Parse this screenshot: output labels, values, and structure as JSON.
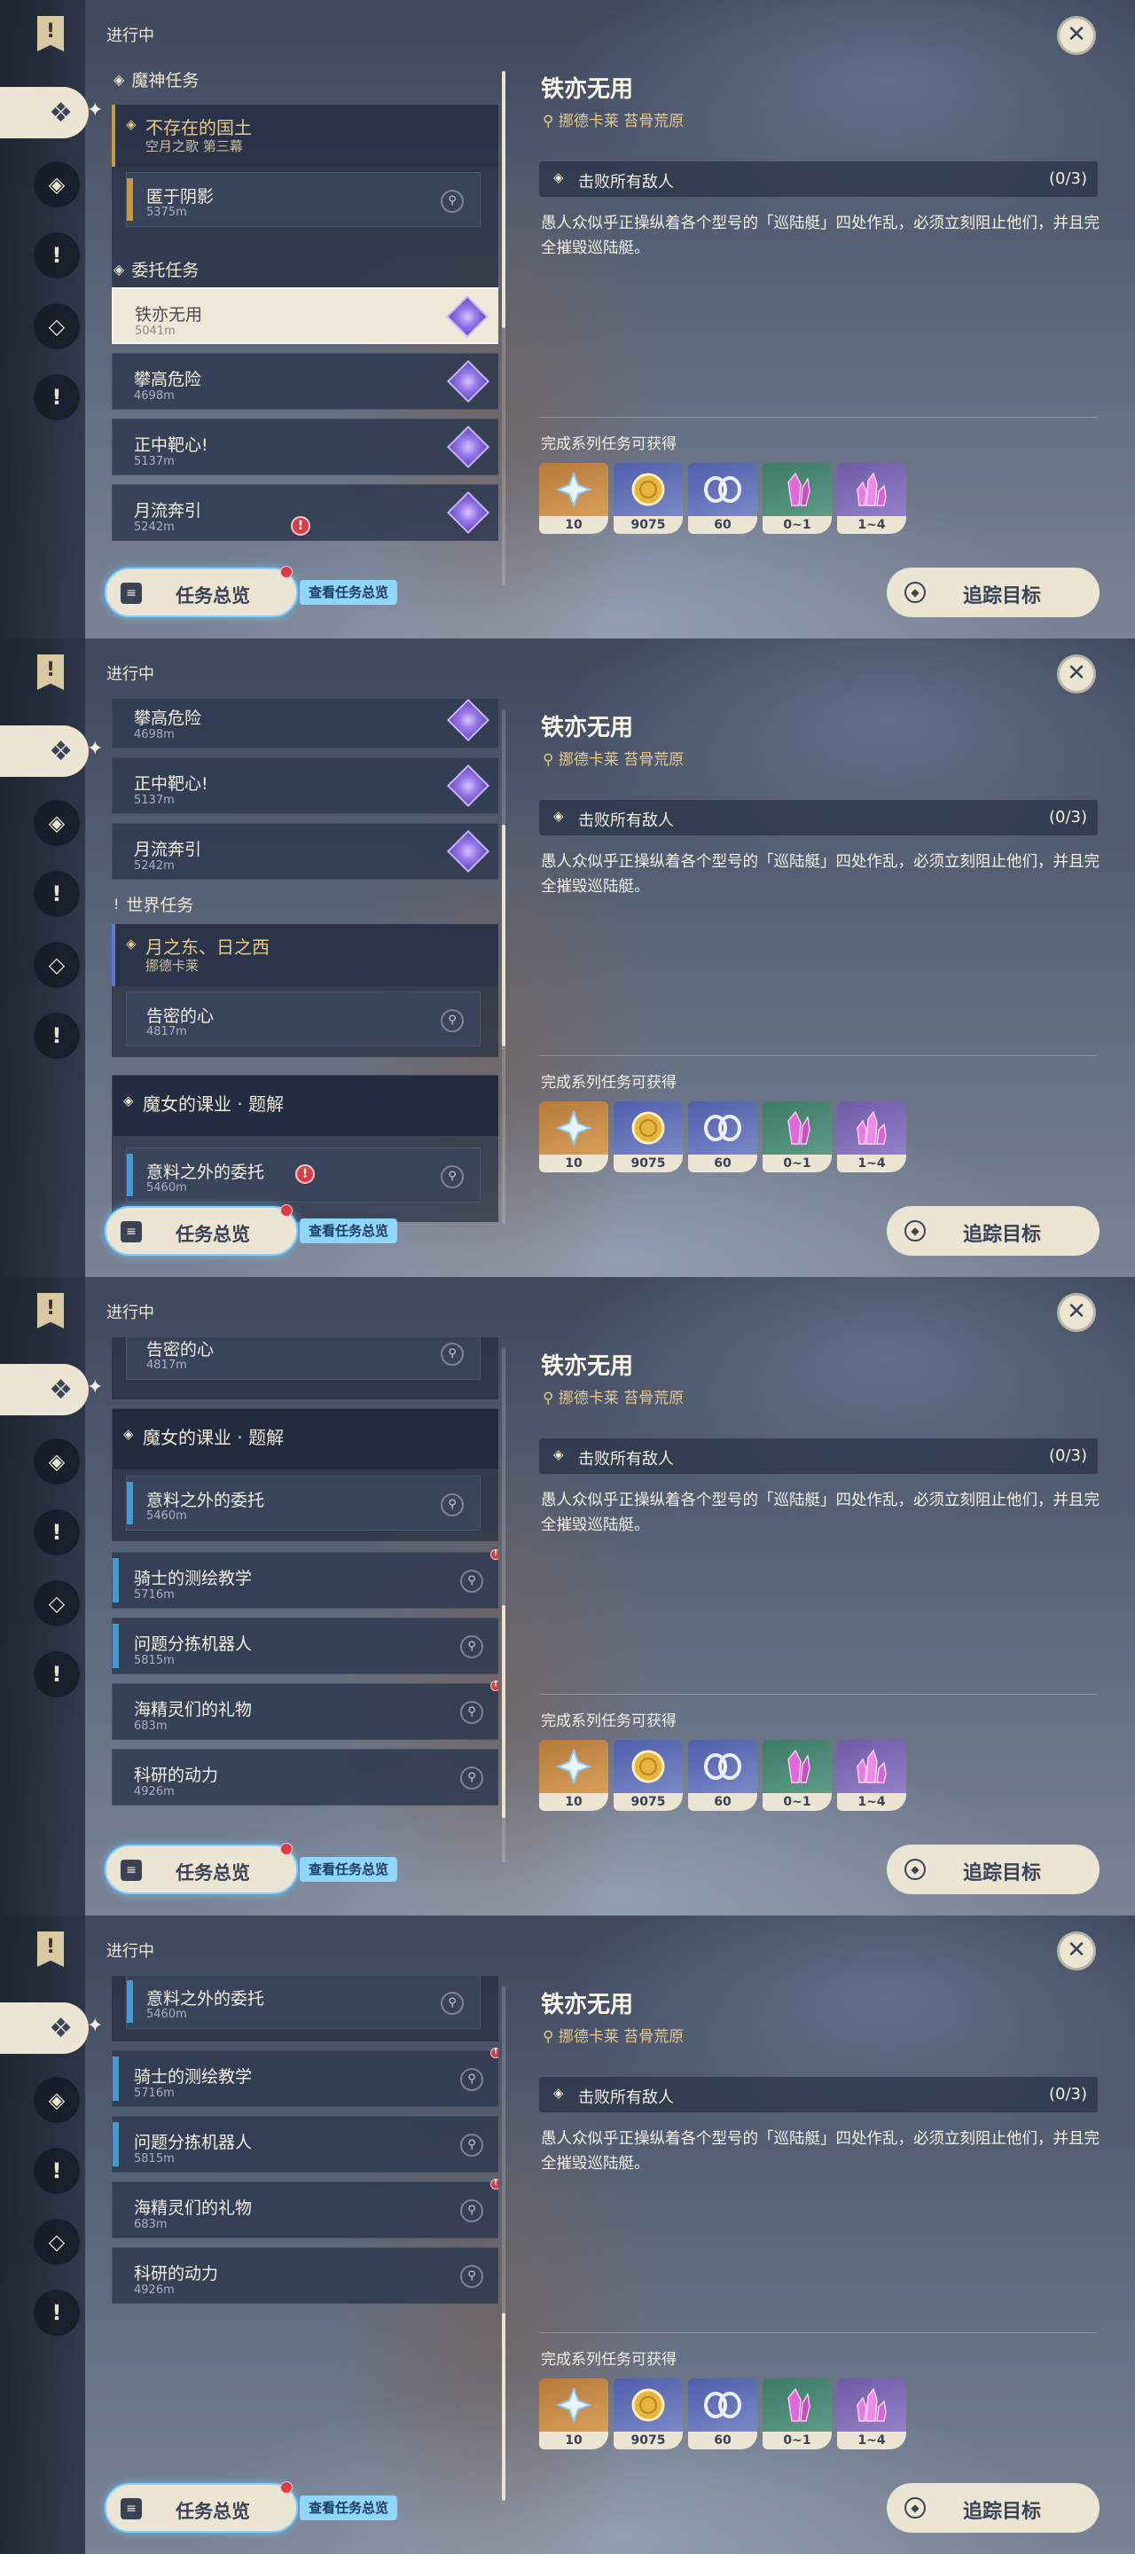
{
  "header": {
    "in_progress": "进行中",
    "close": "✕"
  },
  "rail": {
    "bookmark": "!",
    "active_icon": "❖",
    "icons": [
      "◈",
      "!",
      "◇",
      "!"
    ]
  },
  "sections": {
    "archon": "魔神任务",
    "commission": "委托任务",
    "world": "世界任务"
  },
  "chapter_archon": {
    "title": "不存在的国土",
    "subtitle": "空月之歌 第三幕"
  },
  "chapter_world": {
    "title": "月之东、日之西",
    "subtitle": "挪德卡莱"
  },
  "group_witch": {
    "title": "魔女的课业 · 题解"
  },
  "quests": {
    "hide": {
      "title": "匿于阴影",
      "dist": "5375m"
    },
    "iron": {
      "title": "铁亦无用",
      "dist": "5041m"
    },
    "climb": {
      "title": "攀高危险",
      "dist": "4698m"
    },
    "bull": {
      "title": "正中靶心!",
      "dist": "5137m"
    },
    "moon": {
      "title": "月流奔引",
      "dist": "5242m"
    },
    "secret": {
      "title": "告密的心",
      "dist": "4817m"
    },
    "unexpected": {
      "title": "意料之外的委托",
      "dist": "5460m"
    },
    "knight": {
      "title": "骑士的测绘教学",
      "dist": "5716m"
    },
    "robot": {
      "title": "问题分拣机器人",
      "dist": "5815m"
    },
    "spirit": {
      "title": "海精灵们的礼物",
      "dist": "683m"
    },
    "research": {
      "title": "科研的动力",
      "dist": "4926m"
    }
  },
  "detail": {
    "title": "铁亦无用",
    "location": "挪德卡莱 苔骨荒原",
    "objective": "击败所有敌人",
    "objective_count": "(0/3)",
    "description": "愚人众似乎正操纵着各个型号的「巡陆艇」四处作乱，必须立刻阻止他们，并且完全摧毁巡陆艇。",
    "rewards_label": "完成系列任务可获得",
    "rewards": [
      {
        "icon": "primogem-icon",
        "amount": "10"
      },
      {
        "icon": "mora-icon",
        "amount": "9075"
      },
      {
        "icon": "exp-icon",
        "amount": "60"
      },
      {
        "icon": "crystal-icon",
        "amount": "0~1"
      },
      {
        "icon": "crystal-cluster-icon",
        "amount": "1~4"
      }
    ]
  },
  "footer": {
    "overview": "任务总览",
    "overview_tag": "查看任务总览",
    "track": "追踪目标"
  },
  "colors": {
    "accent": "#ece5d3",
    "gold": "#e7c98a",
    "commission": "#9b7bea",
    "alert": "#d83d45",
    "world": "#3f9bd6"
  }
}
